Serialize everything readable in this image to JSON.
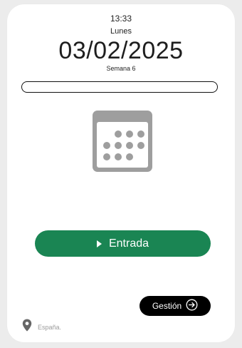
{
  "header": {
    "time": "13:33",
    "day": "Lunes",
    "date": "03/02/2025",
    "week": "Semana 6"
  },
  "icons": {
    "calendar": "calendar-icon",
    "play": "play-icon",
    "arrow": "arrow-right-circle-icon",
    "location": "map-pin-icon"
  },
  "actions": {
    "entrada_label": "Entrada",
    "gestion_label": "Gestión"
  },
  "footer": {
    "location": "España."
  },
  "colors": {
    "primary": "#1a8553",
    "dark": "#000000",
    "icon_gray": "#9e9e9e"
  }
}
